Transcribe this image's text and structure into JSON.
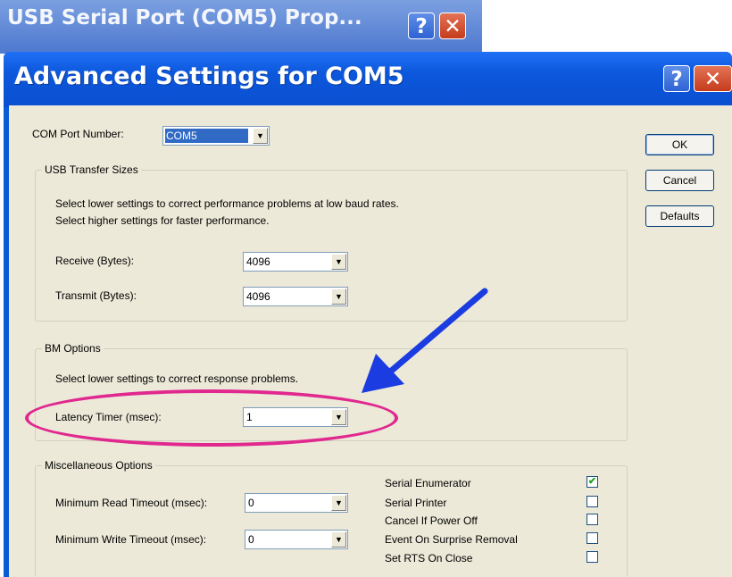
{
  "background_window": {
    "title": "USB Serial Port (COM5) Prop...",
    "help_glyph": "?",
    "close_glyph": "✕"
  },
  "dialog": {
    "title": "Advanced Settings for COM5",
    "help_glyph": "?",
    "close_glyph": "✕",
    "com_port": {
      "label": "COM Port Number:",
      "value": "COM5"
    },
    "buttons": {
      "ok": "OK",
      "cancel": "Cancel",
      "defaults": "Defaults"
    },
    "usb_transfer": {
      "title": "USB Transfer Sizes",
      "line1": "Select lower settings to correct performance problems at low baud rates.",
      "line2": "Select higher settings for faster performance.",
      "receive_label": "Receive (Bytes):",
      "receive_value": "4096",
      "transmit_label": "Transmit (Bytes):",
      "transmit_value": "4096"
    },
    "bm_options": {
      "title": "BM Options",
      "line1": "Select lower settings to correct response problems.",
      "latency_label": "Latency Timer (msec):",
      "latency_value": "1"
    },
    "misc": {
      "title": "Miscellaneous Options",
      "min_read_label": "Minimum Read Timeout (msec):",
      "min_read_value": "0",
      "min_write_label": "Minimum Write Timeout (msec):",
      "min_write_value": "0",
      "checkboxes": [
        {
          "label": "Serial Enumerator",
          "checked": true
        },
        {
          "label": "Serial Printer",
          "checked": false
        },
        {
          "label": "Cancel If Power Off",
          "checked": false
        },
        {
          "label": "Event On Surprise Removal",
          "checked": false
        },
        {
          "label": "Set RTS On Close",
          "checked": false
        }
      ]
    }
  },
  "annotation": {
    "ellipse_color": "#e0288f",
    "arrow_color": "#1a3ce0"
  },
  "colors": {
    "titlebar_blue": "#0a57d8",
    "dialog_face": "#ece9d8",
    "selection_blue": "#316ac5"
  },
  "icons": {
    "dropdown": "▼",
    "check": "✔"
  }
}
